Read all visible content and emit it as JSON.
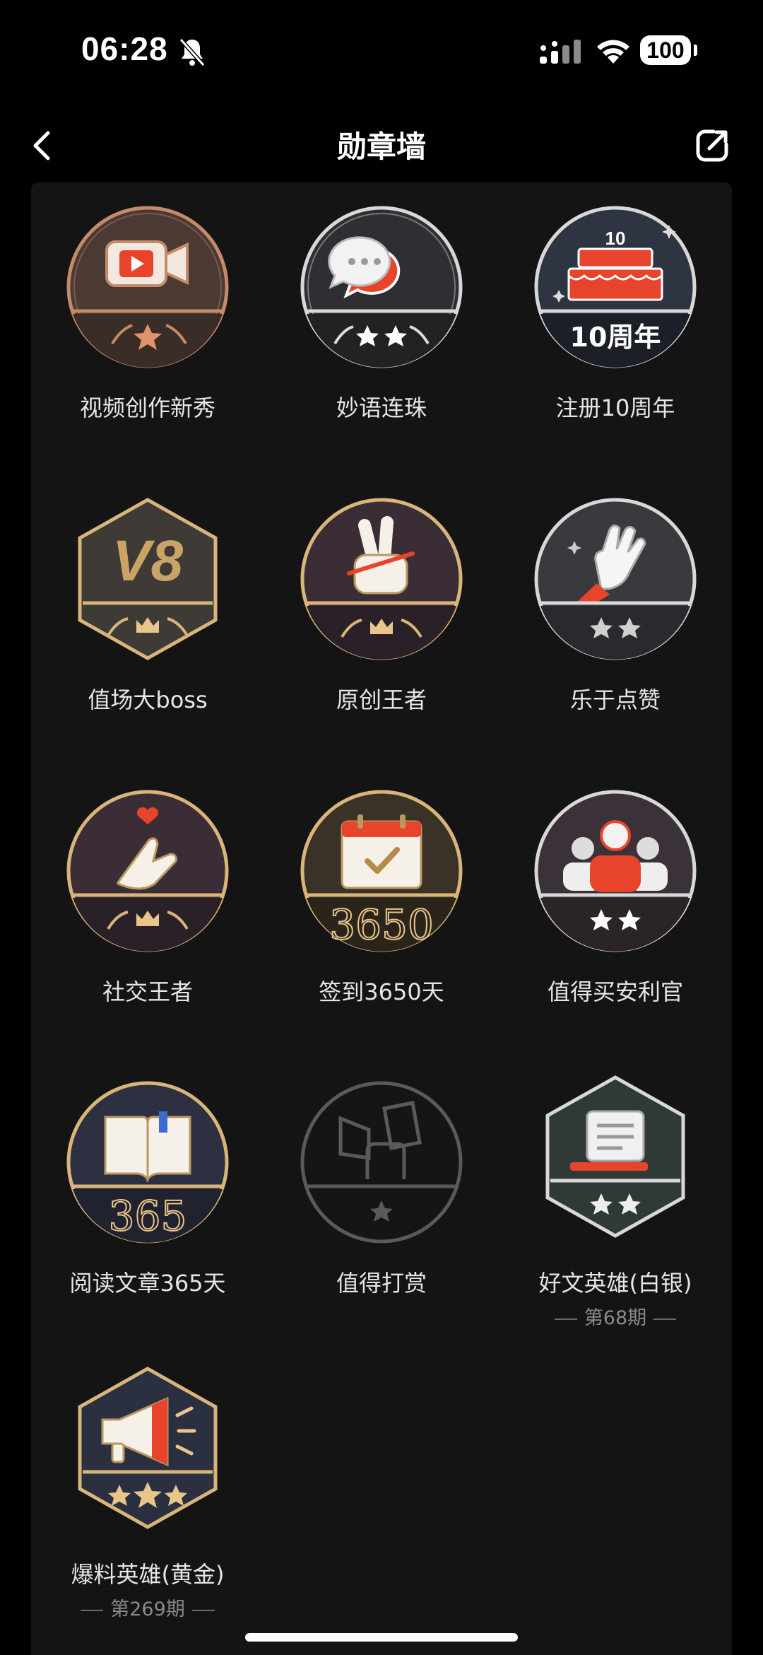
{
  "status_bar": {
    "time": "06:28",
    "battery": "100",
    "icons": [
      "bell-muted-icon",
      "cellular-signal-icon",
      "wifi-icon",
      "battery-icon"
    ]
  },
  "nav": {
    "title": "勋章墙",
    "back_icon": "chevron-left-icon",
    "share_icon": "share-icon"
  },
  "badges": [
    {
      "label": "视频创作新秀",
      "icon": "video-camera-icon"
    },
    {
      "label": "妙语连珠",
      "icon": "chat-bubbles-icon"
    },
    {
      "label": "注册10周年",
      "icon": "cake-icon",
      "art_text": "10周年",
      "art_top_text": "10"
    },
    {
      "label": "值场大boss",
      "icon": "v8-icon",
      "art_text": "V8"
    },
    {
      "label": "原创王者",
      "icon": "victory-hand-icon"
    },
    {
      "label": "乐于点赞",
      "icon": "hand-wave-icon"
    },
    {
      "label": "社交王者",
      "icon": "finger-heart-icon"
    },
    {
      "label": "签到3650天",
      "icon": "calendar-check-icon",
      "art_text": "3650"
    },
    {
      "label": "值得买安利官",
      "icon": "people-icon"
    },
    {
      "label": "阅读文章365天",
      "icon": "open-book-icon",
      "art_text": "365"
    },
    {
      "label": "值得打赏",
      "icon": "megaphone-fist-icon"
    },
    {
      "label": "好文英雄(白银)",
      "icon": "scroll-icon",
      "issue": "第68期"
    },
    {
      "label": "爆料英雄(黄金)",
      "icon": "megaphone-icon",
      "issue": "第269期"
    }
  ],
  "colors": {
    "background": "#000000",
    "panel": "#141414",
    "bronze": "#c48a6a",
    "silver": "#cfcfcf",
    "gold": "#d9b57a",
    "accent_red": "#e8442c"
  }
}
